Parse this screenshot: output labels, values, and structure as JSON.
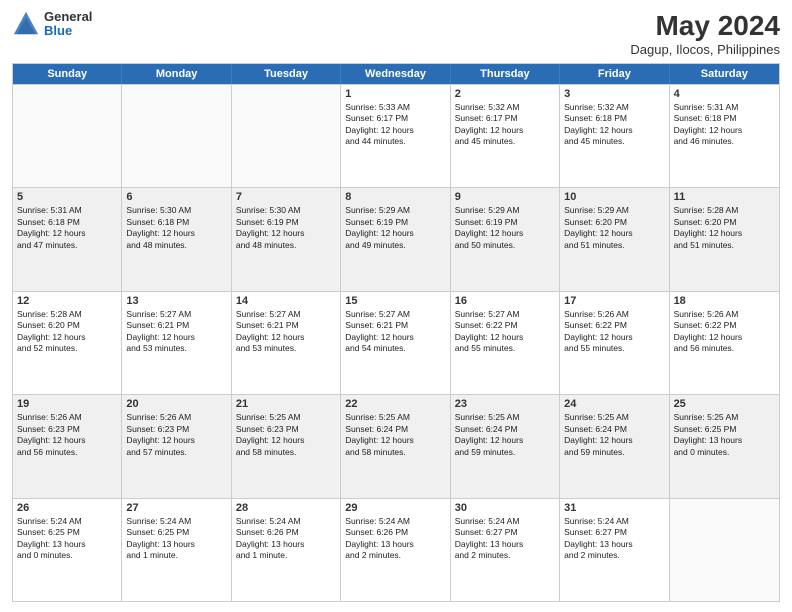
{
  "header": {
    "logo_general": "General",
    "logo_blue": "Blue",
    "main_title": "May 2024",
    "subtitle": "Dagup, Ilocos, Philippines"
  },
  "weekdays": [
    "Sunday",
    "Monday",
    "Tuesday",
    "Wednesday",
    "Thursday",
    "Friday",
    "Saturday"
  ],
  "rows": [
    [
      {
        "day": "",
        "text": ""
      },
      {
        "day": "",
        "text": ""
      },
      {
        "day": "",
        "text": ""
      },
      {
        "day": "1",
        "text": "Sunrise: 5:33 AM\nSunset: 6:17 PM\nDaylight: 12 hours\nand 44 minutes."
      },
      {
        "day": "2",
        "text": "Sunrise: 5:32 AM\nSunset: 6:17 PM\nDaylight: 12 hours\nand 45 minutes."
      },
      {
        "day": "3",
        "text": "Sunrise: 5:32 AM\nSunset: 6:18 PM\nDaylight: 12 hours\nand 45 minutes."
      },
      {
        "day": "4",
        "text": "Sunrise: 5:31 AM\nSunset: 6:18 PM\nDaylight: 12 hours\nand 46 minutes."
      }
    ],
    [
      {
        "day": "5",
        "text": "Sunrise: 5:31 AM\nSunset: 6:18 PM\nDaylight: 12 hours\nand 47 minutes."
      },
      {
        "day": "6",
        "text": "Sunrise: 5:30 AM\nSunset: 6:18 PM\nDaylight: 12 hours\nand 48 minutes."
      },
      {
        "day": "7",
        "text": "Sunrise: 5:30 AM\nSunset: 6:19 PM\nDaylight: 12 hours\nand 48 minutes."
      },
      {
        "day": "8",
        "text": "Sunrise: 5:29 AM\nSunset: 6:19 PM\nDaylight: 12 hours\nand 49 minutes."
      },
      {
        "day": "9",
        "text": "Sunrise: 5:29 AM\nSunset: 6:19 PM\nDaylight: 12 hours\nand 50 minutes."
      },
      {
        "day": "10",
        "text": "Sunrise: 5:29 AM\nSunset: 6:20 PM\nDaylight: 12 hours\nand 51 minutes."
      },
      {
        "day": "11",
        "text": "Sunrise: 5:28 AM\nSunset: 6:20 PM\nDaylight: 12 hours\nand 51 minutes."
      }
    ],
    [
      {
        "day": "12",
        "text": "Sunrise: 5:28 AM\nSunset: 6:20 PM\nDaylight: 12 hours\nand 52 minutes."
      },
      {
        "day": "13",
        "text": "Sunrise: 5:27 AM\nSunset: 6:21 PM\nDaylight: 12 hours\nand 53 minutes."
      },
      {
        "day": "14",
        "text": "Sunrise: 5:27 AM\nSunset: 6:21 PM\nDaylight: 12 hours\nand 53 minutes."
      },
      {
        "day": "15",
        "text": "Sunrise: 5:27 AM\nSunset: 6:21 PM\nDaylight: 12 hours\nand 54 minutes."
      },
      {
        "day": "16",
        "text": "Sunrise: 5:27 AM\nSunset: 6:22 PM\nDaylight: 12 hours\nand 55 minutes."
      },
      {
        "day": "17",
        "text": "Sunrise: 5:26 AM\nSunset: 6:22 PM\nDaylight: 12 hours\nand 55 minutes."
      },
      {
        "day": "18",
        "text": "Sunrise: 5:26 AM\nSunset: 6:22 PM\nDaylight: 12 hours\nand 56 minutes."
      }
    ],
    [
      {
        "day": "19",
        "text": "Sunrise: 5:26 AM\nSunset: 6:23 PM\nDaylight: 12 hours\nand 56 minutes."
      },
      {
        "day": "20",
        "text": "Sunrise: 5:26 AM\nSunset: 6:23 PM\nDaylight: 12 hours\nand 57 minutes."
      },
      {
        "day": "21",
        "text": "Sunrise: 5:25 AM\nSunset: 6:23 PM\nDaylight: 12 hours\nand 58 minutes."
      },
      {
        "day": "22",
        "text": "Sunrise: 5:25 AM\nSunset: 6:24 PM\nDaylight: 12 hours\nand 58 minutes."
      },
      {
        "day": "23",
        "text": "Sunrise: 5:25 AM\nSunset: 6:24 PM\nDaylight: 12 hours\nand 59 minutes."
      },
      {
        "day": "24",
        "text": "Sunrise: 5:25 AM\nSunset: 6:24 PM\nDaylight: 12 hours\nand 59 minutes."
      },
      {
        "day": "25",
        "text": "Sunrise: 5:25 AM\nSunset: 6:25 PM\nDaylight: 13 hours\nand 0 minutes."
      }
    ],
    [
      {
        "day": "26",
        "text": "Sunrise: 5:24 AM\nSunset: 6:25 PM\nDaylight: 13 hours\nand 0 minutes."
      },
      {
        "day": "27",
        "text": "Sunrise: 5:24 AM\nSunset: 6:25 PM\nDaylight: 13 hours\nand 1 minute."
      },
      {
        "day": "28",
        "text": "Sunrise: 5:24 AM\nSunset: 6:26 PM\nDaylight: 13 hours\nand 1 minute."
      },
      {
        "day": "29",
        "text": "Sunrise: 5:24 AM\nSunset: 6:26 PM\nDaylight: 13 hours\nand 2 minutes."
      },
      {
        "day": "30",
        "text": "Sunrise: 5:24 AM\nSunset: 6:27 PM\nDaylight: 13 hours\nand 2 minutes."
      },
      {
        "day": "31",
        "text": "Sunrise: 5:24 AM\nSunset: 6:27 PM\nDaylight: 13 hours\nand 2 minutes."
      },
      {
        "day": "",
        "text": ""
      }
    ]
  ]
}
